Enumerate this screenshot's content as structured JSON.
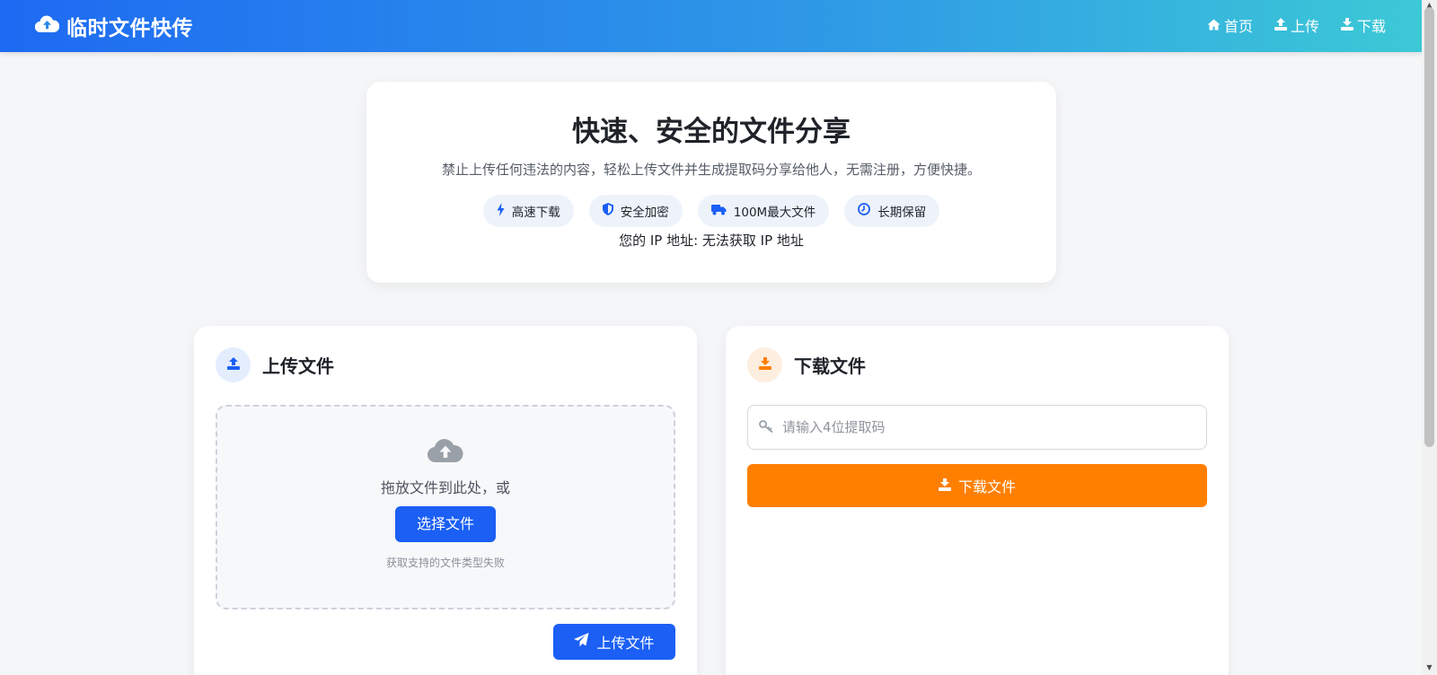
{
  "navbar": {
    "brand": "临时文件快传",
    "links": [
      {
        "label": "首页",
        "icon": "home-icon"
      },
      {
        "label": "上传",
        "icon": "upload-icon"
      },
      {
        "label": "下载",
        "icon": "download-icon"
      }
    ]
  },
  "hero": {
    "title": "快速、安全的文件分享",
    "subtitle": "禁止上传任何违法的内容，轻松上传文件并生成提取码分享给他人，无需注册，方便快捷。",
    "features": [
      {
        "label": "高速下载",
        "icon": "bolt-icon"
      },
      {
        "label": "安全加密",
        "icon": "shield-icon"
      },
      {
        "label": "100M最大文件",
        "icon": "truck-icon"
      },
      {
        "label": "长期保留",
        "icon": "clock-icon"
      }
    ],
    "ip_text": "您的 IP 地址: 无法获取 IP 地址"
  },
  "upload": {
    "title": "上传文件",
    "drop_text": "拖放文件到此处，或",
    "select_button": "选择文件",
    "hint": "获取支持的文件类型失败",
    "upload_button": "上传文件"
  },
  "download": {
    "title": "下载文件",
    "placeholder": "请输入4位提取码",
    "download_button": "下载文件"
  },
  "colors": {
    "primary": "#1b5ff5",
    "accent": "#ff7f00",
    "nav_gradient_start": "#1e6af2",
    "nav_gradient_end": "#3cc9d6"
  }
}
